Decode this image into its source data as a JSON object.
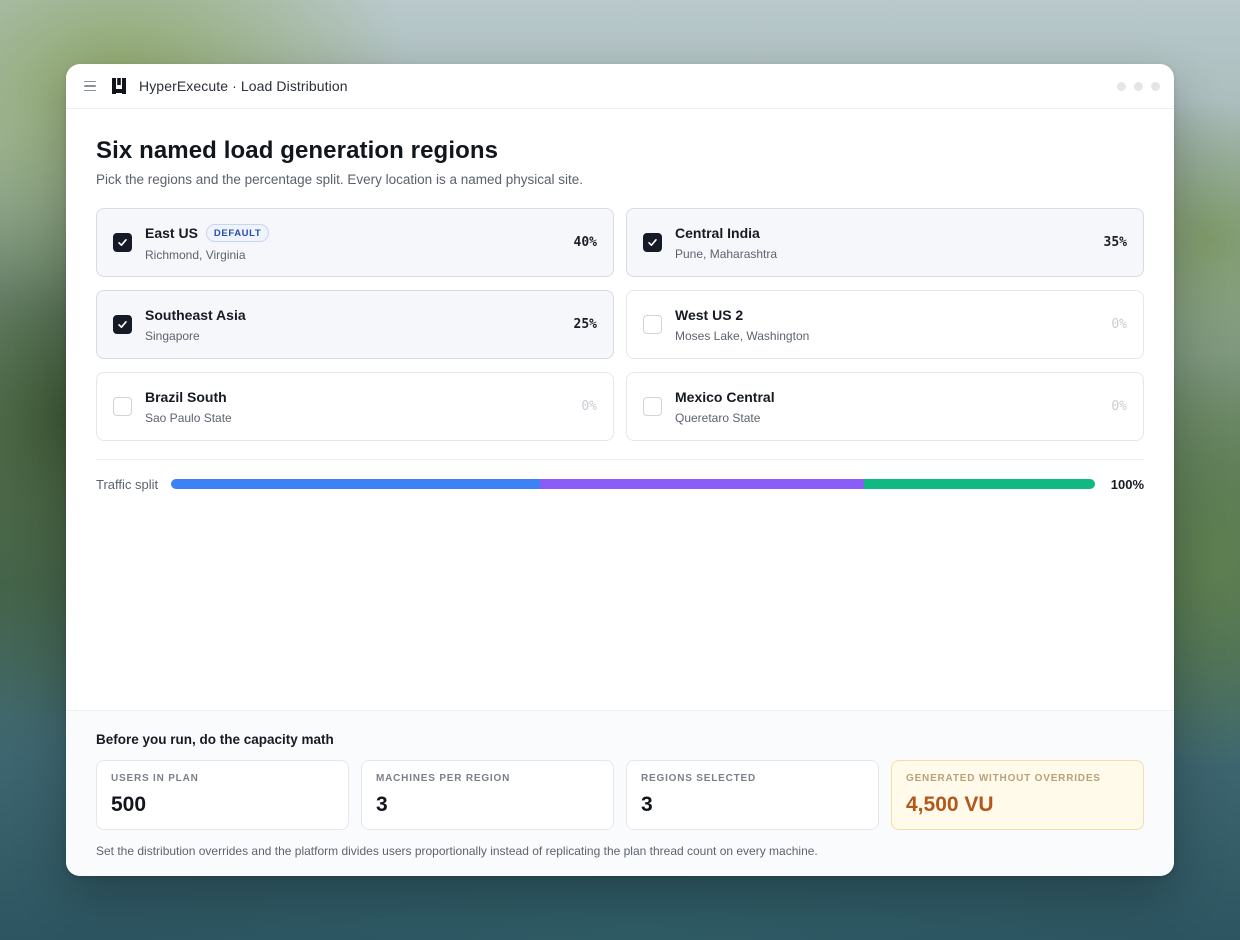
{
  "window": {
    "title": "HyperExecute · Load Distribution"
  },
  "header": {
    "title": "Six named load generation regions",
    "subtitle": "Pick the regions and the percentage split. Every location is a named physical site."
  },
  "regions": [
    {
      "name": "East US",
      "location": "Richmond, Virginia",
      "percent": "40%",
      "selected": true,
      "badge": "DEFAULT"
    },
    {
      "name": "Central India",
      "location": "Pune, Maharashtra",
      "percent": "35%",
      "selected": true
    },
    {
      "name": "Southeast Asia",
      "location": "Singapore",
      "percent": "25%",
      "selected": true
    },
    {
      "name": "West US 2",
      "location": "Moses Lake, Washington",
      "percent": "0%",
      "selected": false
    },
    {
      "name": "Brazil South",
      "location": "Sao Paulo State",
      "percent": "0%",
      "selected": false
    },
    {
      "name": "Mexico Central",
      "location": "Queretaro State",
      "percent": "0%",
      "selected": false
    }
  ],
  "traffic_split": {
    "label": "Traffic split",
    "total": "100%",
    "segments": [
      {
        "region": "East US",
        "fraction": 0.4,
        "color": "#3b82f6"
      },
      {
        "region": "Central India",
        "fraction": 0.35,
        "color": "#8b5cf6"
      },
      {
        "region": "Southeast Asia",
        "fraction": 0.25,
        "color": "#10b981"
      }
    ]
  },
  "capacity": {
    "title": "Before you run, do the capacity math",
    "stats": [
      {
        "label": "USERS IN PLAN",
        "value": "500"
      },
      {
        "label": "MACHINES PER REGION",
        "value": "3"
      },
      {
        "label": "REGIONS SELECTED",
        "value": "3"
      },
      {
        "label": "GENERATED WITHOUT OVERRIDES",
        "value": "4,500 VU"
      }
    ],
    "footnote": "Set the distribution overrides and the platform divides users proportionally instead of replicating the plan thread count on every machine."
  },
  "icons": {
    "menu": "hamburger-icon",
    "logo": "hyperexecute-logo-icon",
    "check": "check-icon"
  }
}
